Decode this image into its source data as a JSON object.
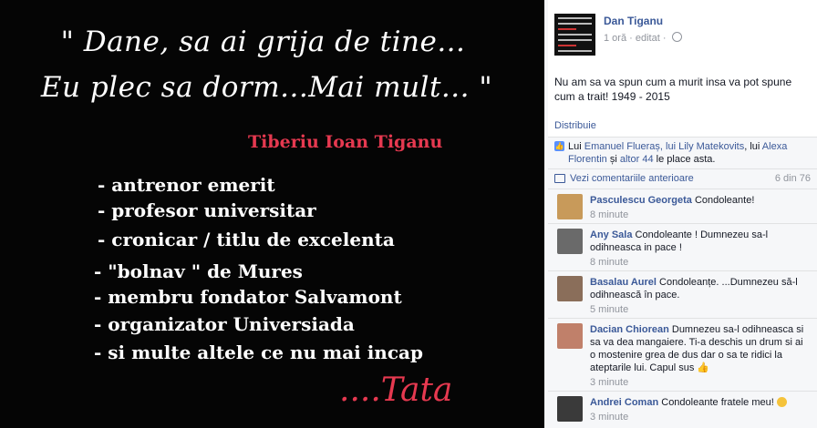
{
  "image": {
    "quote_line1": "\" Dane, sa ai grija de tine...",
    "quote_line2": "Eu plec sa dorm...Mai mult... \"",
    "name": "Tiberiu Ioan Tiganu",
    "items": [
      "- antrenor emerit",
      "- profesor universitar",
      "- cronicar / titlu de excelenta",
      "- \"bolnav \" de Mures",
      "- membru fondator Salvamont",
      "- organizator Universiada",
      "- si multe altele ce nu mai incap"
    ],
    "signature": "....Tata"
  },
  "post": {
    "author": "Dan Tiganu",
    "time": "1 oră",
    "edited": "editat",
    "text": "Nu am sa va spun cum a murit insa va pot spune cum a trait! 1949 - 2015",
    "share_label": "Distribuie"
  },
  "likes": {
    "prefix": "Lui",
    "names": "Emanuel Flueraș, lui Lily Matekovits",
    "mid": ", lui",
    "name3": "Alexa Florentin",
    "and": "și",
    "others": "altor 44",
    "suffix": "le place asta."
  },
  "previous": {
    "label": "Vezi comentariile anterioare",
    "count": "6 din 76"
  },
  "comments": [
    {
      "author": "Pasculescu Georgeta",
      "text": "Condoleante!",
      "time": "8 minute"
    },
    {
      "author": "Any Sala",
      "text": "Condoleante ! Dumnezeu sa-l odihneasca in pace !",
      "time": "8 minute"
    },
    {
      "author": "Basalau Aurel",
      "text": "Condoleanțe. ...Dumnezeu să-l odihnească în pace.",
      "time": "5 minute"
    },
    {
      "author": "Dacian Chiorean",
      "text": "Dumnezeu sa-l odihneasca si sa va dea mangaiere. Ti-a deschis un drum si ai o mostenire grea de dus dar o sa te ridici la ateptarile lui. Capul sus",
      "time": "3 minute"
    },
    {
      "author": "Andrei Coman",
      "text": "Condoleante fratele meu!",
      "time": "3 minute"
    }
  ],
  "colors": {
    "link": "#3b5998",
    "accent_red": "#e63950",
    "panel_bg": "#f6f7f9",
    "photo_bg": "#050505"
  },
  "icons": [
    "globe-icon",
    "like-thumb-icon",
    "comment-bubble-icon",
    "smile-emoji-icon"
  ]
}
